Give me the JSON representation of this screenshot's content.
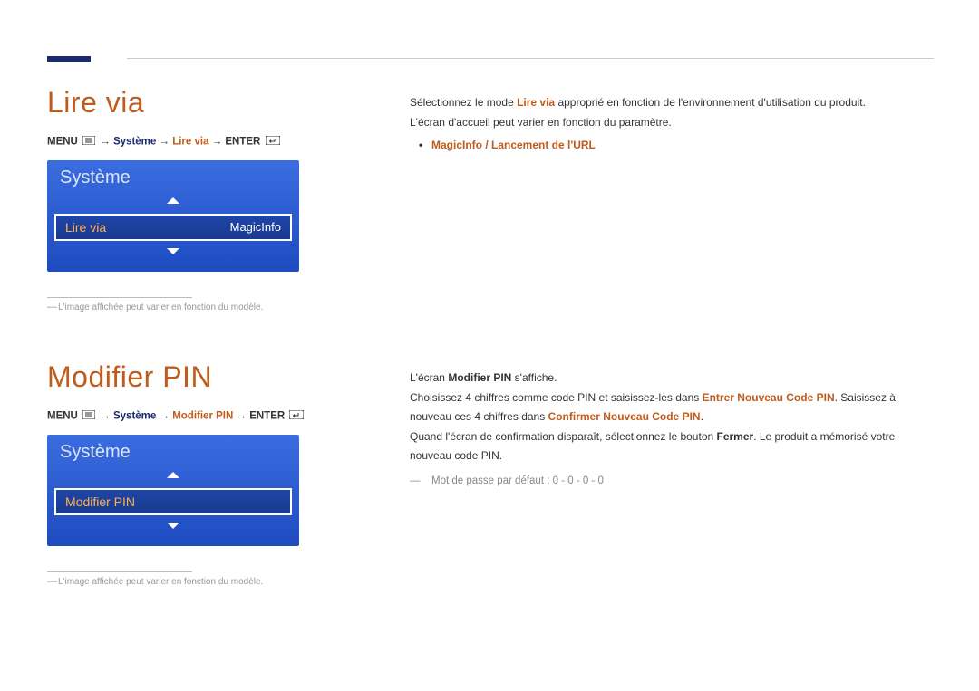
{
  "section1": {
    "heading": "Lire via",
    "nav": {
      "menu_label": "MENU",
      "arrow": " → ",
      "system": "Système",
      "item": "Lire via",
      "enter": "ENTER"
    },
    "panel": {
      "title": "Système",
      "item_label": "Lire via",
      "item_value": "MagicInfo"
    },
    "footnote": "L'image affichée peut varier en fonction du modèle.",
    "right": {
      "line1_pre": "Sélectionnez le mode ",
      "line1_bold": "Lire via",
      "line1_post": " approprié en fonction de l'environnement d'utilisation du produit.",
      "line2": "L'écran d'accueil peut varier en fonction du paramètre.",
      "bullet": "MagicInfo / Lancement de l'URL"
    }
  },
  "section2": {
    "heading": "Modifier PIN",
    "nav": {
      "menu_label": "MENU",
      "arrow": " → ",
      "system": "Système",
      "item": "Modifier PIN",
      "enter": "ENTER"
    },
    "panel": {
      "title": "Système",
      "item_label": "Modifier PIN"
    },
    "footnote": "L'image affichée peut varier en fonction du modèle.",
    "right": {
      "line1_pre": "L'écran ",
      "line1_bold": "Modifier PIN",
      "line1_post": " s'affiche.",
      "line2_pre": "Choisissez 4 chiffres comme code PIN et saisissez-les dans ",
      "line2_accent1": "Entrer Nouveau Code PIN",
      "line2_mid": ". Saisissez à nouveau ces 4 chiffres dans ",
      "line2_accent2": "Confirmer Nouveau Code PIN",
      "line2_post": ".",
      "line3_pre": "Quand l'écran de confirmation disparaît, sélectionnez le bouton ",
      "line3_bold": "Fermer",
      "line3_post": ". Le produit a mémorisé votre nouveau code PIN.",
      "note": "Mot de passe par défaut : 0 - 0 - 0 - 0"
    }
  }
}
